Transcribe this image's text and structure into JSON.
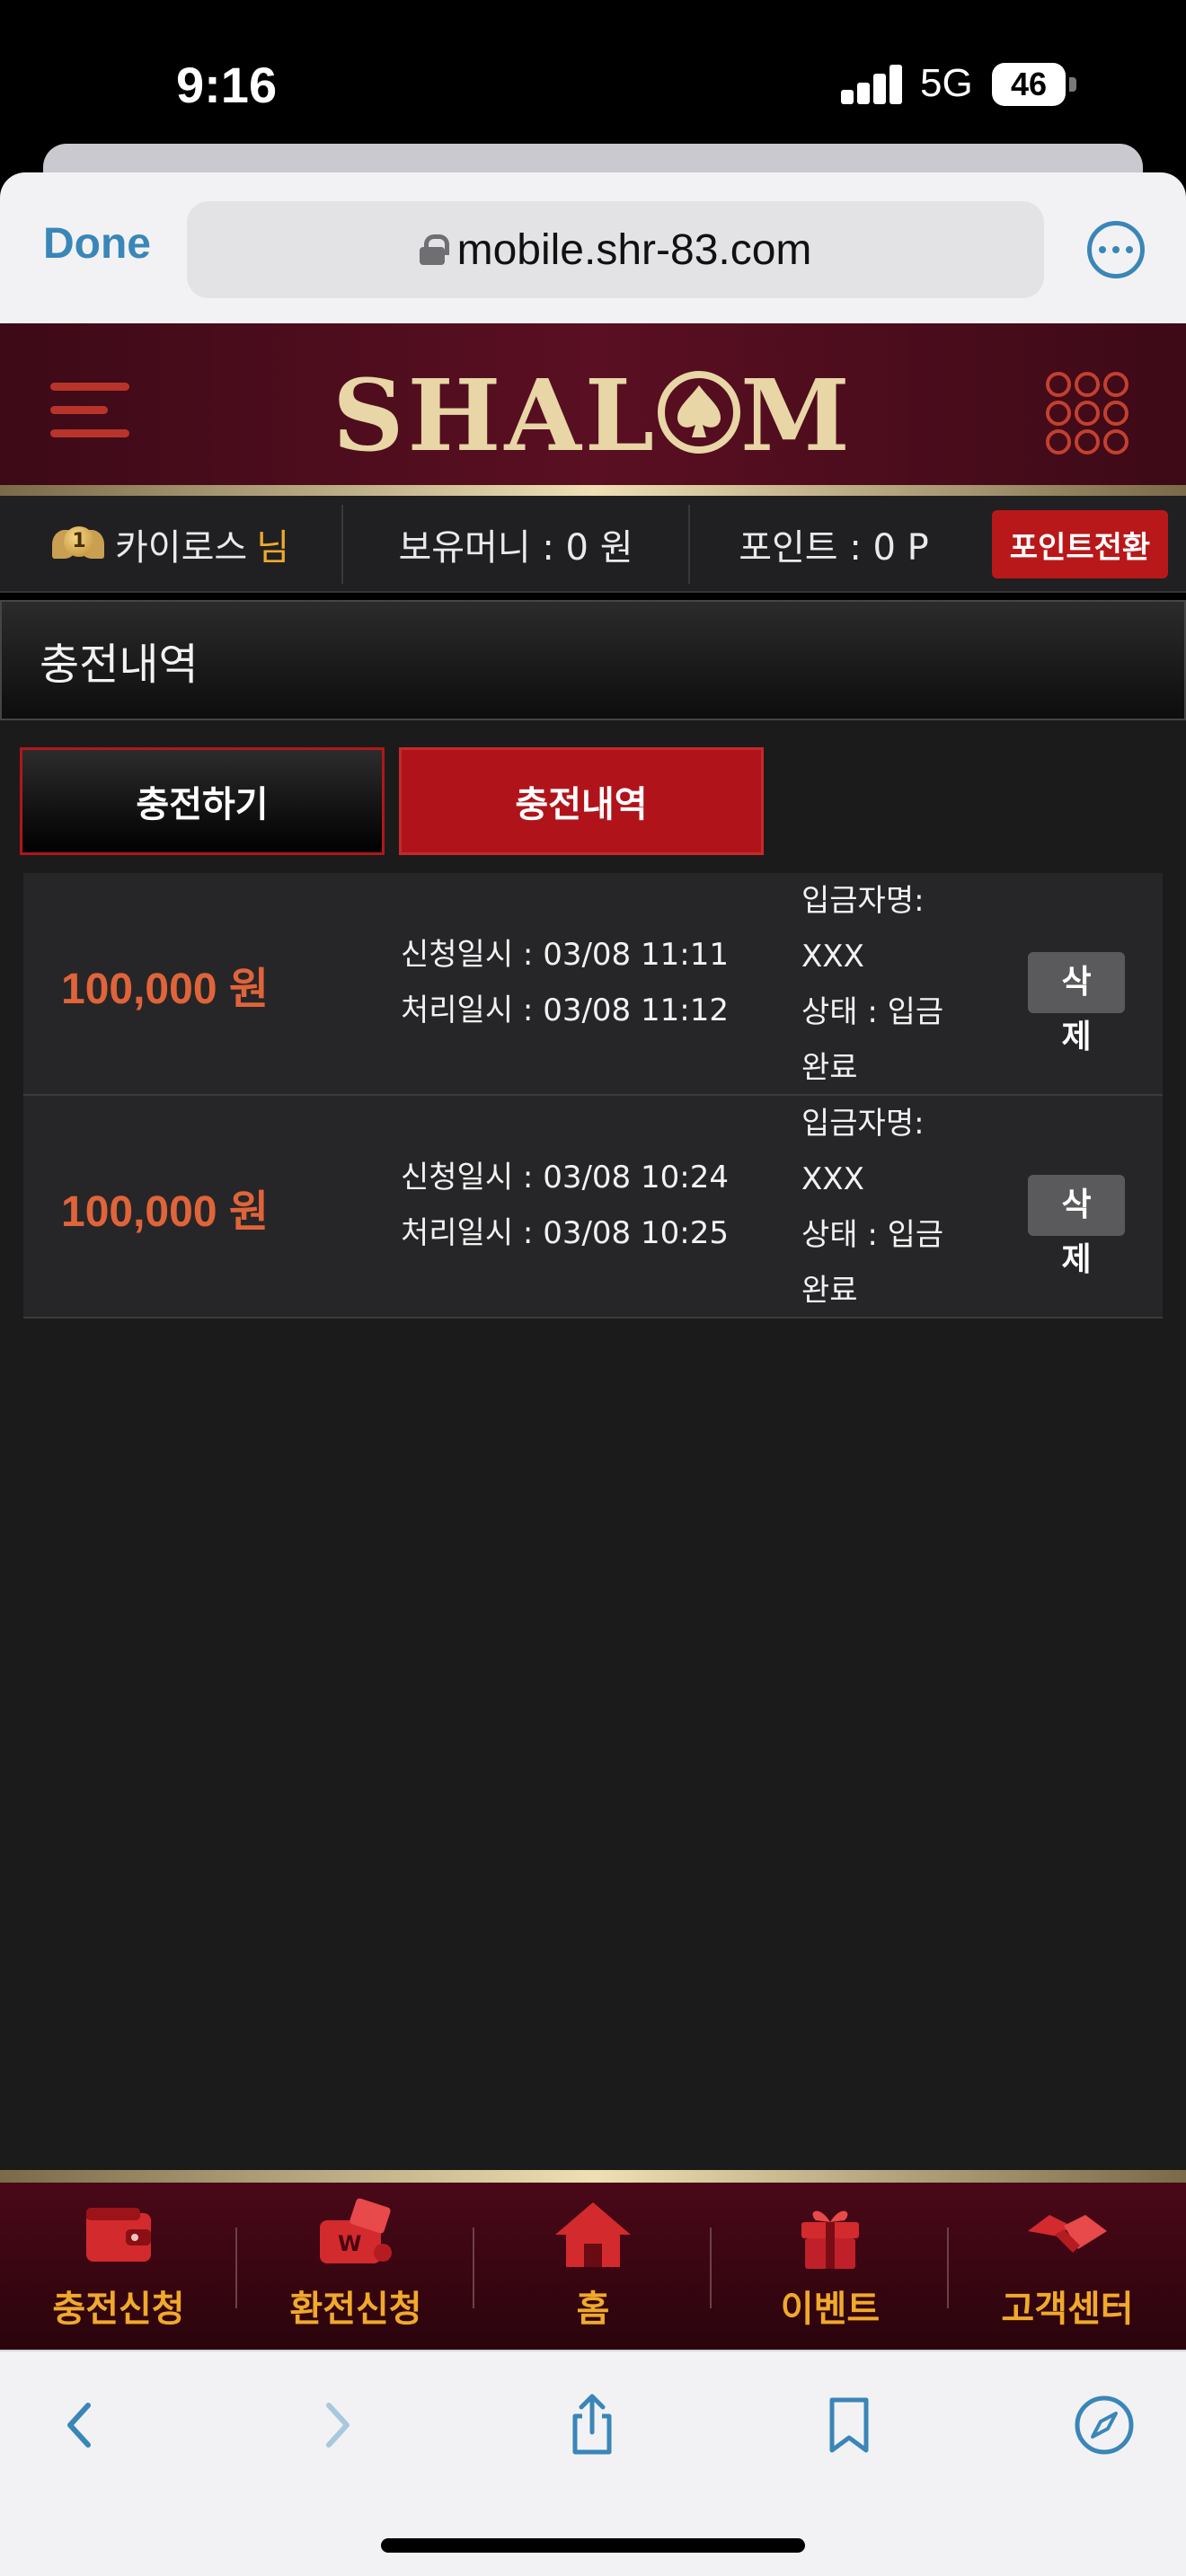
{
  "status_bar": {
    "time": "9:16",
    "network": "5G",
    "battery": "46"
  },
  "browser": {
    "done_label": "Done",
    "url": "mobile.shr-83.com",
    "more_icon": "more-icon"
  },
  "site": {
    "logo": "SHAL",
    "logo_end": "M",
    "brand_color": "#b0141a",
    "accent_gold": "#f0a92b"
  },
  "user_bar": {
    "level": "1",
    "username": "카이로스",
    "honorific": "님",
    "balance": "보유머니 : 0 원",
    "points": "포인트 : 0 P",
    "convert_button": "포인트전환"
  },
  "page": {
    "title": "충전내역"
  },
  "tabs": [
    {
      "label": "충전하기",
      "active": false
    },
    {
      "label": "충전내역",
      "active": true
    }
  ],
  "records": [
    {
      "amount": "100,000 원",
      "requested": "신청일시 : 03/08 11:11",
      "processed": "처리일시 : 03/08 11:12",
      "depositor_label": "입금자명:",
      "depositor_name": "XXX",
      "status_label": "상태 : 입금",
      "status_value": "완료",
      "delete_line1": "삭",
      "delete_line2": "제"
    },
    {
      "amount": "100,000 원",
      "requested": "신청일시 : 03/08 10:24",
      "processed": "처리일시 : 03/08 10:25",
      "depositor_label": "입금자명:",
      "depositor_name": "XXX",
      "status_label": "상태 : 입금",
      "status_value": "완료",
      "delete_line1": "삭",
      "delete_line2": "제"
    }
  ],
  "bottom_nav": [
    {
      "label": "충전신청",
      "icon": "wallet-icon"
    },
    {
      "label": "환전신청",
      "icon": "exchange-wallet-icon"
    },
    {
      "label": "홈",
      "icon": "home-icon"
    },
    {
      "label": "이벤트",
      "icon": "gift-icon"
    },
    {
      "label": "고객센터",
      "icon": "handshake-icon"
    }
  ],
  "toolbar": [
    "back-icon",
    "forward-icon",
    "share-icon",
    "bookmarks-icon",
    "compass-icon"
  ]
}
